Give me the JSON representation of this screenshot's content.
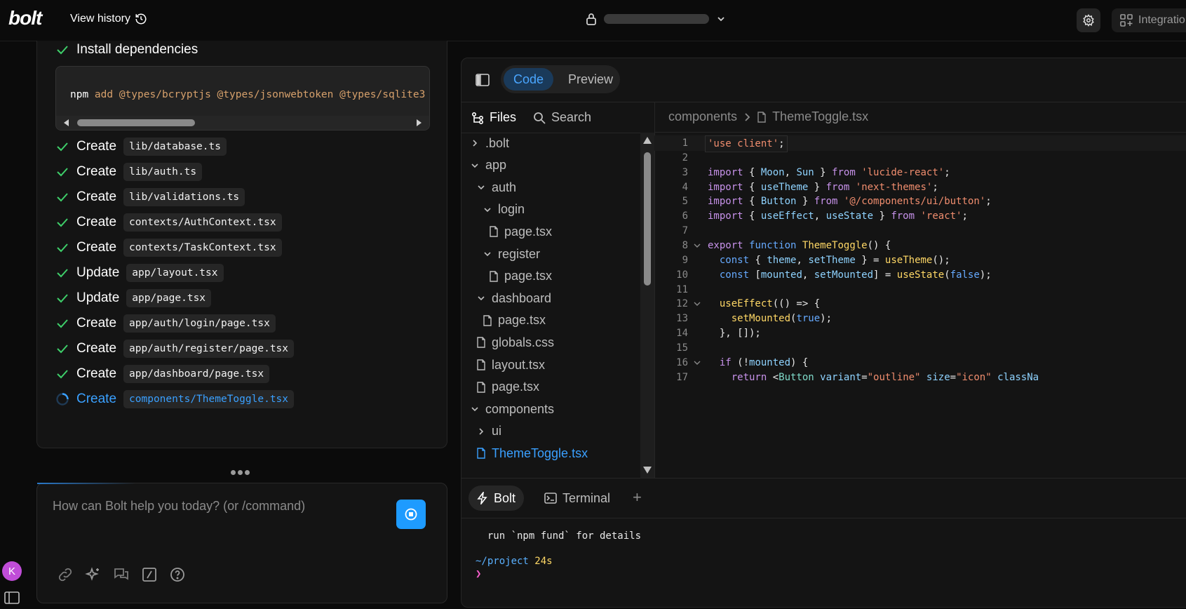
{
  "topbar": {
    "logo": "bolt",
    "view_history": "View history",
    "integrations": "Integratio"
  },
  "chat": {
    "steps": [
      {
        "verb": "Install dependencies",
        "file": "",
        "status": "done"
      },
      {
        "verb": "Create",
        "file": "lib/database.ts",
        "status": "done"
      },
      {
        "verb": "Create",
        "file": "lib/auth.ts",
        "status": "done"
      },
      {
        "verb": "Create",
        "file": "lib/validations.ts",
        "status": "done"
      },
      {
        "verb": "Create",
        "file": "contexts/AuthContext.tsx",
        "status": "done"
      },
      {
        "verb": "Create",
        "file": "contexts/TaskContext.tsx",
        "status": "done"
      },
      {
        "verb": "Update",
        "file": "app/layout.tsx",
        "status": "done"
      },
      {
        "verb": "Update",
        "file": "app/page.tsx",
        "status": "done"
      },
      {
        "verb": "Create",
        "file": "app/auth/login/page.tsx",
        "status": "done"
      },
      {
        "verb": "Create",
        "file": "app/auth/register/page.tsx",
        "status": "done"
      },
      {
        "verb": "Create",
        "file": "app/dashboard/page.tsx",
        "status": "done"
      },
      {
        "verb": "Create",
        "file": "components/ThemeToggle.tsx",
        "status": "loading"
      }
    ],
    "command": {
      "prefix": "npm",
      "rest": " add @types/bcryptjs @types/jsonwebtoken @types/sqlite3"
    },
    "input_placeholder": "How can Bolt help you today? (or /command)",
    "avatar_initial": "K"
  },
  "workbench": {
    "tabs": [
      "Code",
      "Preview"
    ],
    "active_tab": "Code",
    "files_label": "Files",
    "search_label": "Search",
    "tree": [
      {
        "name": ".bolt",
        "type": "folder",
        "open": false,
        "depth": 0
      },
      {
        "name": "app",
        "type": "folder",
        "open": true,
        "depth": 0
      },
      {
        "name": "auth",
        "type": "folder",
        "open": true,
        "depth": 1
      },
      {
        "name": "login",
        "type": "folder",
        "open": true,
        "depth": 2
      },
      {
        "name": "page.tsx",
        "type": "file",
        "depth": 3
      },
      {
        "name": "register",
        "type": "folder",
        "open": true,
        "depth": 2
      },
      {
        "name": "page.tsx",
        "type": "file",
        "depth": 3
      },
      {
        "name": "dashboard",
        "type": "folder",
        "open": true,
        "depth": 1
      },
      {
        "name": "page.tsx",
        "type": "file",
        "depth": 2
      },
      {
        "name": "globals.css",
        "type": "file",
        "depth": 1
      },
      {
        "name": "layout.tsx",
        "type": "file",
        "depth": 1
      },
      {
        "name": "page.tsx",
        "type": "file",
        "depth": 1
      },
      {
        "name": "components",
        "type": "folder",
        "open": true,
        "depth": 0
      },
      {
        "name": "ui",
        "type": "folder",
        "open": false,
        "depth": 1
      },
      {
        "name": "ThemeToggle.tsx",
        "type": "file",
        "depth": 1,
        "selected": true
      }
    ],
    "breadcrumb": [
      "components",
      "ThemeToggle.tsx"
    ],
    "code_lines": [
      {
        "n": "1",
        "fold": false,
        "html": "<span class=\"s\">'use client'</span>;"
      },
      {
        "n": "2",
        "fold": false,
        "html": ""
      },
      {
        "n": "3",
        "fold": false,
        "html": "<span class=\"k\">import</span> { <span class=\"v\">Moon</span>, <span class=\"v\">Sun</span> } <span class=\"k\">from</span> <span class=\"s\">'lucide-react'</span>;"
      },
      {
        "n": "4",
        "fold": false,
        "html": "<span class=\"k\">import</span> { <span class=\"v\">useTheme</span> } <span class=\"k\">from</span> <span class=\"s\">'next-themes'</span>;"
      },
      {
        "n": "5",
        "fold": false,
        "html": "<span class=\"k\">import</span> { <span class=\"v\">Button</span> } <span class=\"k\">from</span> <span class=\"s\">'@/components/ui/button'</span>;"
      },
      {
        "n": "6",
        "fold": false,
        "html": "<span class=\"k\">import</span> { <span class=\"v\">useEffect</span>, <span class=\"v\">useState</span> } <span class=\"k\">from</span> <span class=\"s\">'react'</span>;"
      },
      {
        "n": "7",
        "fold": false,
        "html": ""
      },
      {
        "n": "8",
        "fold": true,
        "html": "<span class=\"k\">export</span> <span class=\"c\">function</span> <span class=\"f\">ThemeToggle</span>() {"
      },
      {
        "n": "9",
        "fold": false,
        "html": "  <span class=\"c\">const</span> { <span class=\"v\">theme</span>, <span class=\"v\">setTheme</span> } = <span class=\"f\">useTheme</span>();"
      },
      {
        "n": "10",
        "fold": false,
        "html": "  <span class=\"c\">const</span> [<span class=\"v\">mounted</span>, <span class=\"v\">setMounted</span>] = <span class=\"f\">useState</span>(<span class=\"c\">false</span>);"
      },
      {
        "n": "11",
        "fold": false,
        "html": ""
      },
      {
        "n": "12",
        "fold": true,
        "html": "  <span class=\"f\">useEffect</span>(() =&gt; {"
      },
      {
        "n": "13",
        "fold": false,
        "html": "    <span class=\"f\">setMounted</span>(<span class=\"c\">true</span>);"
      },
      {
        "n": "14",
        "fold": false,
        "html": "  }, []);"
      },
      {
        "n": "15",
        "fold": false,
        "html": ""
      },
      {
        "n": "16",
        "fold": true,
        "html": "  <span class=\"k\">if</span> (!<span class=\"v\">mounted</span>) {"
      },
      {
        "n": "17",
        "fold": false,
        "html": "    <span class=\"k\">return</span> &lt;<span class=\"t\">Button</span> <span class=\"v\">variant</span>=<span class=\"s\">\"outline\"</span> <span class=\"v\">size</span>=<span class=\"s\">\"icon\"</span> <span class=\"v\">classNa</span>"
      }
    ],
    "terminal_tabs": [
      "Bolt",
      "Terminal"
    ],
    "terminal_lines": [
      "  run `npm fund` for details",
      "",
      "~/project 24s",
      "❯"
    ]
  },
  "colors": {
    "accent": "#1e9bff",
    "success": "#3ecf6a",
    "avatar": "#c04dd8"
  }
}
